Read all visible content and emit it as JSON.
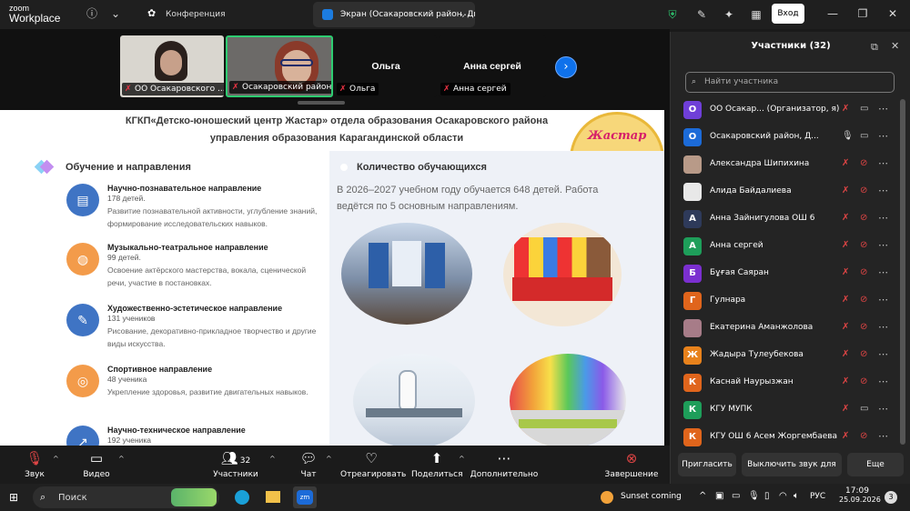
{
  "app": {
    "logo_line1": "zoom",
    "logo_line2": "Workplace"
  },
  "tabs": [
    {
      "label": "Конференция",
      "icon": "paw-icon"
    },
    {
      "label": "Экран (Осакаровский район, Дк",
      "icon": "screen-share-icon"
    }
  ],
  "titlebar": {
    "signin_label": "Вход"
  },
  "thumbnails": [
    {
      "label": "ОО Осакаровского ..."
    },
    {
      "label": "Осакаровский район, Д..."
    },
    {
      "name": "Ольга",
      "label": "Ольга"
    },
    {
      "name": "Анна сергей",
      "label": "Анна сергей"
    }
  ],
  "slide": {
    "title_line1": "КГКП«Детско-юношеский центр Жастар» отдела образования Осакаровского района",
    "title_line2": "управления образования Карагандинской области",
    "logo_text": "Жастар",
    "section_title": "Обучение и направления",
    "items": [
      {
        "title": "Научно-познавательное направление",
        "count": "178 детей.",
        "desc": "Развитие познавательной активности, углубление знаний, формирование исследовательских навыков."
      },
      {
        "title": "Музыкально-театральное направление",
        "count": "99 детей.",
        "desc": "Освоение актёрского мастерства, вокала, сценической речи, участие в постановках."
      },
      {
        "title": "Художественно-эстетическое направление",
        "count": "131 учеников",
        "desc": "Рисование, декоративно-прикладное творчество и другие виды искусства."
      },
      {
        "title": "Спортивное направление",
        "count": "48 ученика",
        "desc": "Укрепление здоровья, развитие двигательных навыков."
      },
      {
        "title": "Научно-техническое направление",
        "count": "192 ученика",
        "desc": ""
      }
    ],
    "right_title": "Количество обучающихся",
    "right_text": "В 2026–2027 учебном году обучается 648 детей. Работа ведётся по 5 основным направлениям."
  },
  "controls": {
    "audio": "Звук",
    "video": "Видео",
    "participants": "Участники",
    "participants_count": "32",
    "chat": "Чат",
    "react": "Отреагировать",
    "share": "Поделиться",
    "more": "Дополнительно",
    "end": "Завершение"
  },
  "panel": {
    "title": "Участники (32)",
    "search_placeholder": "Найти участника",
    "participants": [
      {
        "initial": "О",
        "name": "ОО Осакар...  (Организатор, я)",
        "color": "#6f3fd8",
        "mic": "muted",
        "cam": "on"
      },
      {
        "initial": "О",
        "name": "Осакаровский район, Д...",
        "color": "#1c6bd8",
        "mic": "on",
        "cam": "on"
      },
      {
        "initial": "",
        "name": "Александра Шипихина",
        "color": "#b89a88",
        "mic": "muted",
        "cam": "off"
      },
      {
        "initial": "",
        "name": "Алида Байдалиева",
        "color": "#e8e8e8",
        "mic": "muted",
        "cam": "off"
      },
      {
        "initial": "А",
        "name": "Анна Зайнигулова ОШ 6",
        "color": "#2e3a5a",
        "mic": "muted",
        "cam": "off"
      },
      {
        "initial": "А",
        "name": "Анна сергей",
        "color": "#1e9e5a",
        "mic": "muted",
        "cam": "off"
      },
      {
        "initial": "Б",
        "name": "Бұғая Саяран",
        "color": "#7b2fd0",
        "mic": "muted",
        "cam": "off"
      },
      {
        "initial": "Г",
        "name": "Гулнара",
        "color": "#e0651c",
        "mic": "muted",
        "cam": "off"
      },
      {
        "initial": "",
        "name": "Екатерина Аманжолова",
        "color": "#a77c88",
        "mic": "muted",
        "cam": "off"
      },
      {
        "initial": "Ж",
        "name": "Жадыра Тулеубекова",
        "color": "#e8821c",
        "mic": "muted",
        "cam": "off"
      },
      {
        "initial": "К",
        "name": "Каснай Наурызжан",
        "color": "#e0651c",
        "mic": "muted",
        "cam": "off"
      },
      {
        "initial": "К",
        "name": "КГУ МУПК",
        "color": "#1e9e5a",
        "mic": "muted",
        "cam": "on"
      },
      {
        "initial": "К",
        "name": "КГУ ОШ 6 Асем Жоргембаева",
        "color": "#e0651c",
        "mic": "muted",
        "cam": "off"
      }
    ],
    "invite": "Пригласить",
    "mute_all": "Выключить звук для всех",
    "more": "Еще"
  },
  "taskbar": {
    "search": "Поиск",
    "weather": "Sunset coming",
    "lang": "РУС",
    "time": "17:09",
    "date": "25.09.2026",
    "notif": "3"
  }
}
